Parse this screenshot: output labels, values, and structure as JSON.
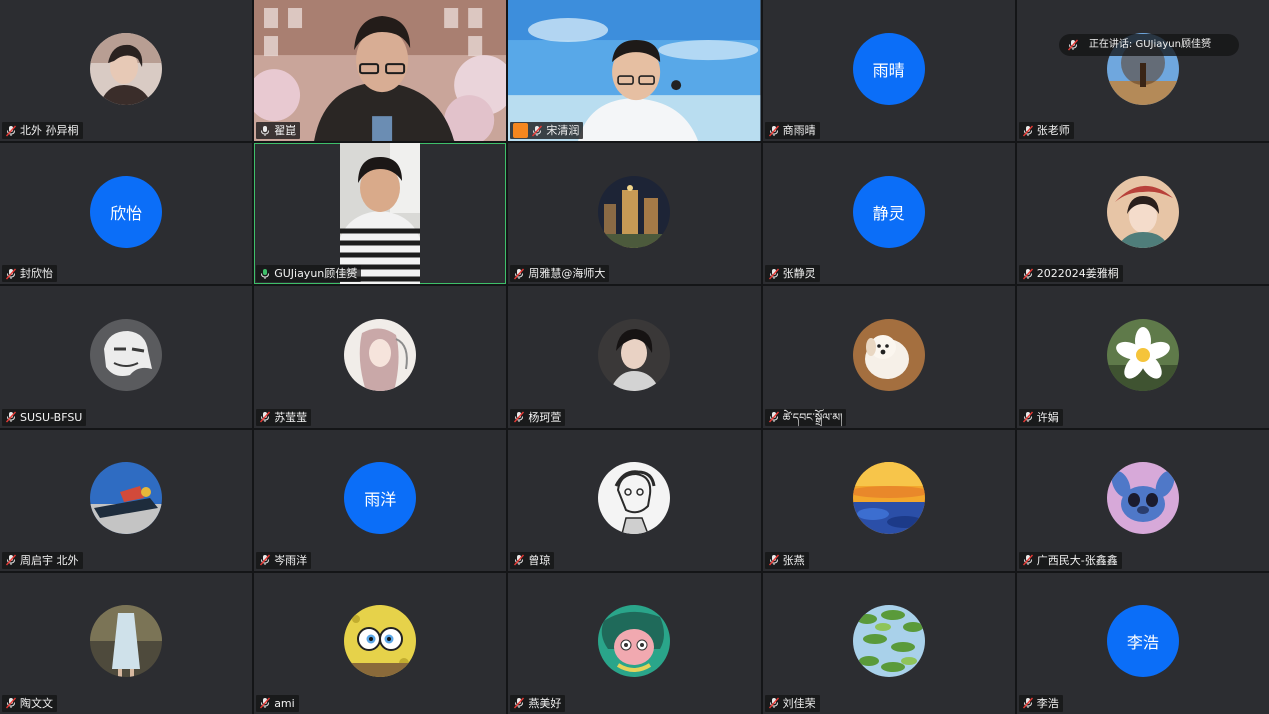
{
  "speaking_indicator": {
    "text": "正在讲话: GUJiayun顾佳赟"
  },
  "participants": [
    {
      "name": "北外 孙异桐",
      "type": "avatar",
      "icon": "portrait-photo-avatar"
    },
    {
      "name": "翟崑",
      "type": "video"
    },
    {
      "name": "宋清润",
      "type": "video",
      "host": true
    },
    {
      "name": "商雨晴",
      "type": "initials",
      "initials": "雨晴"
    },
    {
      "name": "张老师",
      "type": "avatar",
      "icon": "tree-landscape-avatar"
    },
    {
      "name": "封欣怡",
      "type": "initials",
      "initials": "欣怡"
    },
    {
      "name": "GUJiayun顾佳赟",
      "type": "video",
      "speaking": true
    },
    {
      "name": "周雅慧@海师大",
      "type": "avatar",
      "icon": "night-city-avatar"
    },
    {
      "name": "张静灵",
      "type": "initials",
      "initials": "静灵"
    },
    {
      "name": "2022024姜雅桐",
      "type": "avatar",
      "icon": "illustrated-girl-avatar"
    },
    {
      "name": "SUSU-BFSU",
      "type": "avatar",
      "icon": "sketch-face-avatar"
    },
    {
      "name": "苏莹莹",
      "type": "avatar",
      "icon": "anime-girl-avatar"
    },
    {
      "name": "杨珂萱",
      "type": "avatar",
      "icon": "portrait-photo-avatar"
    },
    {
      "name": "ཚེ་དབང་སྒྲོལ་མ།",
      "type": "avatar",
      "icon": "puppy-avatar"
    },
    {
      "name": "许娟",
      "type": "avatar",
      "icon": "flower-avatar"
    },
    {
      "name": "周启宇 北外",
      "type": "avatar",
      "icon": "boat-avatar"
    },
    {
      "name": "岑雨洋",
      "type": "initials",
      "initials": "雨洋"
    },
    {
      "name": "曾琼",
      "type": "avatar",
      "icon": "comic-sketch-avatar"
    },
    {
      "name": "张燕",
      "type": "avatar",
      "icon": "sunset-avatar"
    },
    {
      "name": "广西民大-张鑫鑫",
      "type": "avatar",
      "icon": "stitch-cartoon-avatar"
    },
    {
      "name": "陶文文",
      "type": "avatar",
      "icon": "dress-photo-avatar"
    },
    {
      "name": "ami",
      "type": "avatar",
      "icon": "spongebob-avatar"
    },
    {
      "name": "燕美好",
      "type": "avatar",
      "icon": "anime-character-avatar"
    },
    {
      "name": "刘佳荣",
      "type": "avatar",
      "icon": "green-leaves-avatar"
    },
    {
      "name": "李浩",
      "type": "initials",
      "initials": "李浩"
    }
  ],
  "colors": {
    "tile_bg": "#2c2d31",
    "initials_bg": "#0b6ef8",
    "speaking_border": "#3fbf6a",
    "host_badge": "#f5871f"
  }
}
